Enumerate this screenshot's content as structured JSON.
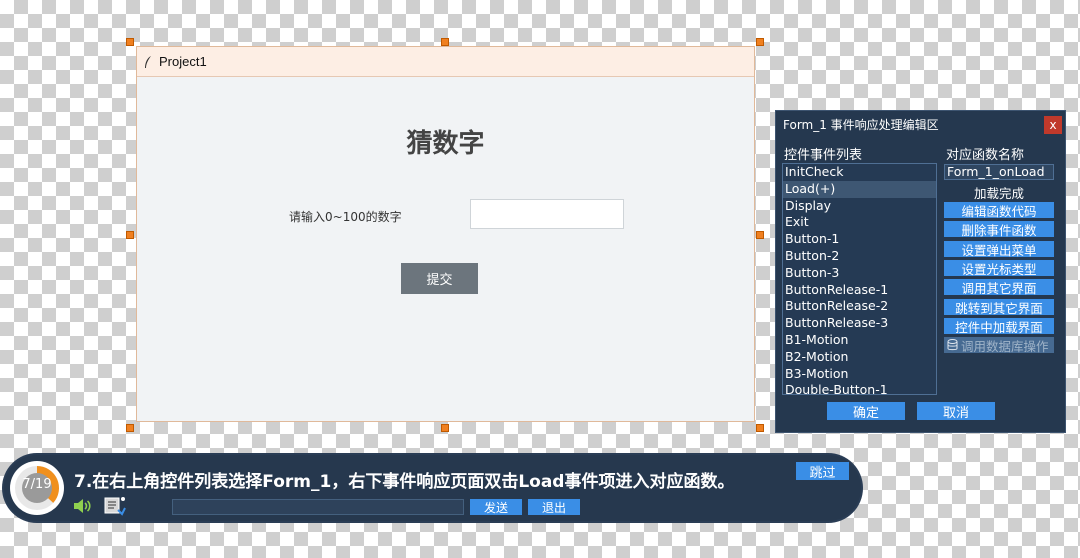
{
  "form": {
    "title": "Project1",
    "heading": "猜数字",
    "prompt": "请输入0~100的数字",
    "input_value": "",
    "submit_label": "提交"
  },
  "event_panel": {
    "title": "Form_1 事件响应处理编辑区",
    "close_label": "x",
    "list_header": "控件事件列表",
    "func_header": "对应函数名称",
    "events": [
      "InitCheck",
      "Load(+)",
      "Display",
      "Exit",
      "Button-1",
      "Button-2",
      "Button-3",
      "ButtonRelease-1",
      "ButtonRelease-2",
      "ButtonRelease-3",
      "B1-Motion",
      "B2-Motion",
      "B3-Motion",
      "Double-Button-1"
    ],
    "selected_event": "Load(+)",
    "func_name": "Form_1_onLoad",
    "status": "加载完成",
    "buttons": [
      "编辑函数代码",
      "删除事件函数",
      "设置弹出菜单",
      "设置光标类型",
      "调用其它界面",
      "跳转到其它界面",
      "控件中加载界面",
      "调用数据库操作"
    ],
    "ok_label": "确定",
    "cancel_label": "取消"
  },
  "tutorial": {
    "progress_text": "7/19",
    "progress_fraction": 0.368,
    "instruction": "7.在右上角控件列表选择Form_1，右下事件响应页面双击Load事件项进入对应函数。",
    "skip_label": "跳过",
    "send_label": "发送",
    "exit_label": "退出"
  },
  "colors": {
    "accent": "#3a8ee6",
    "panel_bg": "#25384f",
    "handle": "#f08020",
    "progress": "#f0901e"
  }
}
